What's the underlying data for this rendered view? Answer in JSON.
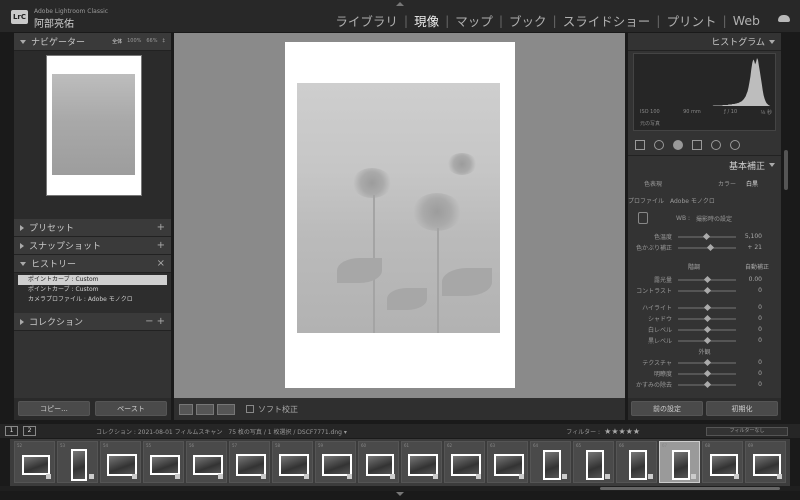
{
  "header": {
    "logo": "LrC",
    "app_name": "Adobe Lightroom Classic",
    "user_name": "阿部亮佑",
    "modules": [
      "ライブラリ",
      "現像",
      "マップ",
      "ブック",
      "スライドショー",
      "プリント",
      "Web"
    ],
    "active_module": "現像"
  },
  "left_panel": {
    "navigator": {
      "title": "ナビゲーター",
      "zoom": [
        "全体",
        "100%",
        "66%",
        "‡"
      ]
    },
    "presets": {
      "title": "プリセット",
      "action": "+"
    },
    "snapshots": {
      "title": "スナップショット",
      "action": "+"
    },
    "history": {
      "title": "ヒストリー",
      "action": "×",
      "items": [
        "ポイントカーブ : Custom",
        "ポイントカーブ : Custom",
        "カメラプロファイル : Adobe モノクロ"
      ]
    },
    "collections": {
      "title": "コレクション",
      "actions": "− +"
    },
    "copy_label": "コピー...",
    "paste_label": "ペースト"
  },
  "toolbar": {
    "softproof_label": "ソフト校正"
  },
  "right_panel": {
    "histogram": {
      "title": "ヒストグラム",
      "iso": "ISO 100",
      "focal": "90 mm",
      "aperture": "ƒ / 10",
      "shutter": "⅛ 秒",
      "original_photo": "元の写真",
      "values": [
        0,
        0,
        0,
        0,
        0,
        0,
        0,
        0,
        0,
        0,
        0,
        0,
        0,
        0,
        0,
        0,
        0,
        0,
        0,
        0,
        0,
        0,
        0,
        0,
        0,
        0,
        0,
        0,
        0,
        0,
        0,
        0,
        0,
        0,
        0,
        0,
        0,
        0,
        0,
        0,
        0,
        0,
        0,
        0,
        0,
        0,
        0,
        0,
        0,
        0,
        0,
        0,
        0,
        0,
        0,
        0,
        0,
        0,
        0,
        0,
        0,
        0,
        0,
        0,
        0,
        0,
        0,
        0,
        0,
        0,
        0,
        0,
        0,
        0,
        0,
        0,
        0,
        0,
        0,
        0,
        0,
        0,
        0,
        0,
        1,
        1,
        1,
        1,
        1,
        1,
        1,
        1,
        1,
        1,
        2,
        2,
        2,
        2,
        2,
        2,
        3,
        3,
        3,
        3,
        4,
        4,
        4,
        5,
        5,
        6,
        6,
        7,
        8,
        9,
        10,
        12,
        14,
        17,
        20,
        25,
        30,
        38,
        48,
        60,
        75,
        88,
        95,
        92,
        85,
        90,
        98,
        94,
        82,
        70,
        58,
        45,
        32,
        22,
        15,
        10,
        6,
        4,
        2,
        1,
        0,
        0,
        0,
        0,
        0,
        0
      ]
    },
    "basic": {
      "title": "基本補正",
      "treatment_label": "色表現",
      "color": "カラー",
      "bw": "白黒",
      "profile_label": "プロファイル",
      "profile_value": "Adobe モノクロ",
      "wb_label": "WB :",
      "wb_value": "撮影時の設定",
      "temp_label": "色温度",
      "temp_value": "5,100",
      "tint_label": "色かぶり補正",
      "tint_value": "+ 21",
      "tone_label": "階調",
      "auto": "自動補正",
      "sliders": [
        {
          "label": "露光量",
          "value": "0.00",
          "pos": 0.5
        },
        {
          "label": "コントラスト",
          "value": "0",
          "pos": 0.5
        },
        {
          "label": "ハイライト",
          "value": "0",
          "pos": 0.5
        },
        {
          "label": "シャドウ",
          "value": "0",
          "pos": 0.5
        },
        {
          "label": "白レベル",
          "value": "0",
          "pos": 0.5
        },
        {
          "label": "黒レベル",
          "value": "0",
          "pos": 0.5
        }
      ],
      "presence_label": "外観",
      "presence": [
        {
          "label": "テクスチャ",
          "value": "0",
          "pos": 0.5
        },
        {
          "label": "明瞭度",
          "value": "0",
          "pos": 0.5
        },
        {
          "label": "かすみの除去",
          "value": "0",
          "pos": 0.5
        }
      ]
    },
    "prev_label": "前の設定",
    "reset_label": "初期化"
  },
  "filmstrip_bar": {
    "monitor1": "1",
    "monitor2": "2",
    "breadcrumb": "コレクション : 2021-08-01 フィルムスキャン　75 枚の写真 / 1 枚選択 / DSCF7771.dng ▾",
    "filter_label": "フィルター :",
    "stars": "★★★★★",
    "filter_value": "フィルターなし"
  },
  "filmstrip": {
    "thumbs": [
      {
        "num": "52"
      },
      {
        "num": "53"
      },
      {
        "num": "54"
      },
      {
        "num": "55"
      },
      {
        "num": "56"
      },
      {
        "num": "57"
      },
      {
        "num": "58"
      },
      {
        "num": "59"
      },
      {
        "num": "60"
      },
      {
        "num": "61"
      },
      {
        "num": "62"
      },
      {
        "num": "63"
      },
      {
        "num": "64"
      },
      {
        "num": "65"
      },
      {
        "num": "66"
      },
      {
        "num": "67"
      },
      {
        "num": "68"
      },
      {
        "num": "69"
      }
    ],
    "active_index": 15
  }
}
